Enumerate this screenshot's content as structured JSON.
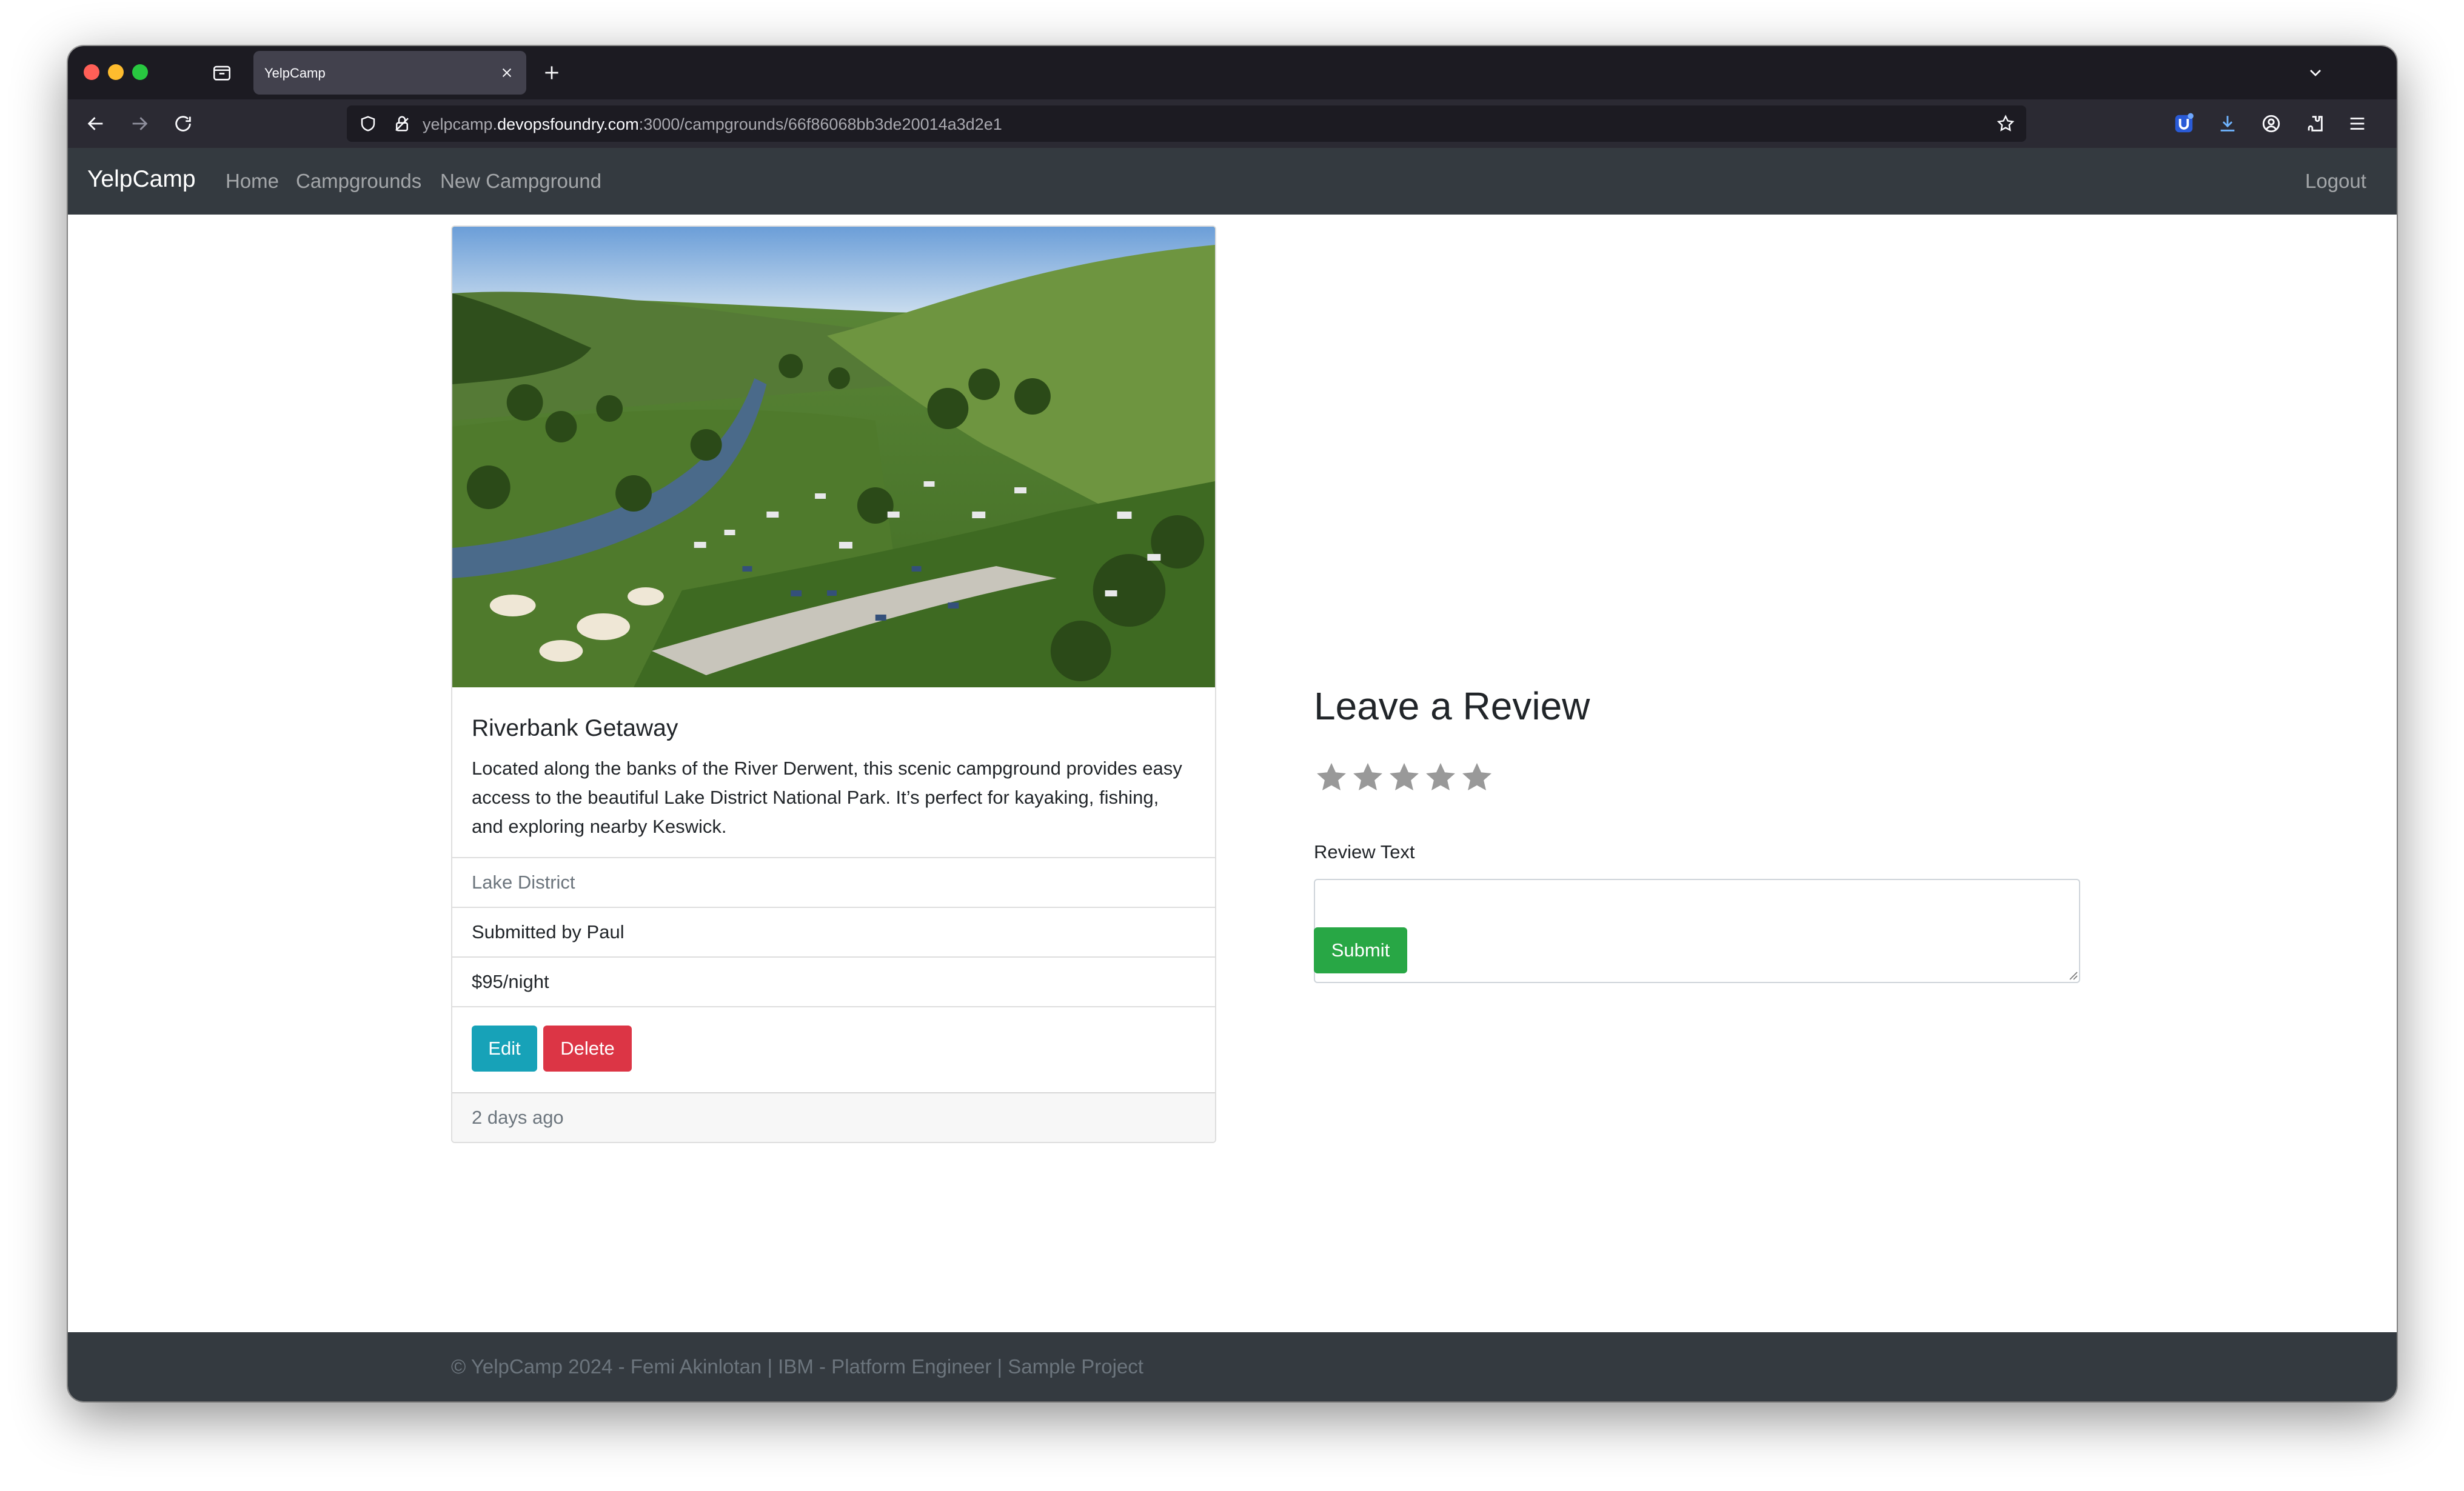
{
  "browser": {
    "tab_title": "YelpCamp",
    "url_prefix": "yelpcamp.",
    "url_host": "devopsfoundry.com",
    "url_rest": ":3000/campgrounds/66f86068bb3de20014a3d2e1",
    "icons": [
      "tab-overview-icon",
      "close-icon",
      "plus-icon",
      "chevron-down-icon",
      "back-arrow-icon",
      "forward-arrow-icon",
      "reload-icon",
      "shield-icon",
      "lock-icon",
      "star-icon",
      "extension-badge-icon",
      "download-icon",
      "account-icon",
      "extensions-icon",
      "menu-icon"
    ]
  },
  "navbar": {
    "brand": "YelpCamp",
    "links": [
      "Home",
      "Campgrounds",
      "New Campground"
    ],
    "logout": "Logout"
  },
  "campground": {
    "image_alt": "Aerial view of campground in a green valley beside a river",
    "title": "Riverbank Getaway",
    "description": "Located along the banks of the River Derwent, this scenic campground provides easy access to the beautiful Lake District National Park. It’s perfect for kayaking, fishing, and exploring nearby Keswick.",
    "location": "Lake District",
    "submitted_by": "Submitted by Paul",
    "price": "$95/night",
    "edit_label": "Edit",
    "delete_label": "Delete",
    "footer": "2 days ago"
  },
  "review": {
    "heading": "Leave a Review",
    "star_count": 5,
    "label": "Review Text",
    "textarea_value": "",
    "submit_label": "Submit"
  },
  "footer": {
    "text": "© YelpCamp 2024 - Femi Akinlotan | IBM - Platform Engineer | Sample Project"
  },
  "colors": {
    "navbar_bg": "#343a40",
    "edit_button": "#17a2b8",
    "delete_button": "#dc3545",
    "submit_button": "#28a745",
    "star_empty": "#999999"
  }
}
